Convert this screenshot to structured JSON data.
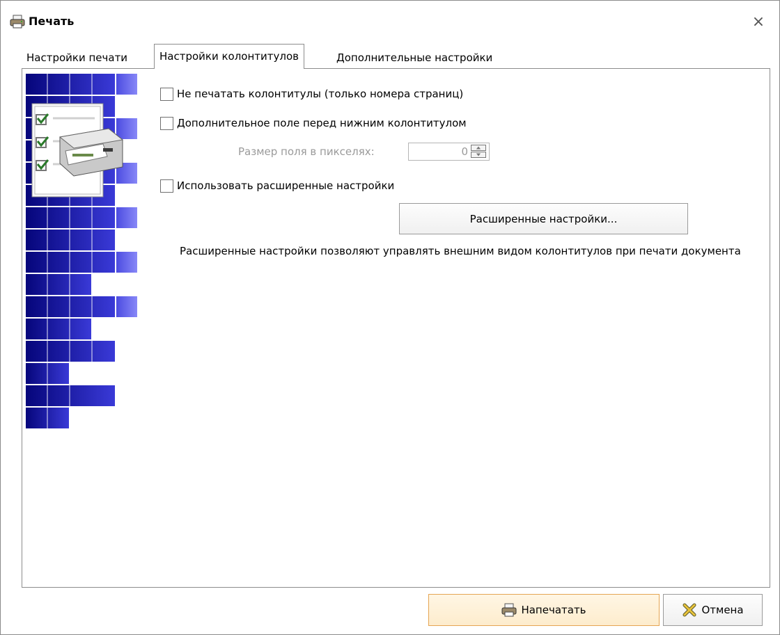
{
  "window": {
    "title": "Печать",
    "close_glyph": "×",
    "icon": "printer-icon"
  },
  "tabs": [
    {
      "label": "Настройки печати",
      "active": false
    },
    {
      "label": "Настройки колонтитулов",
      "active": true
    },
    {
      "label": "Дополнительные настройки",
      "active": false
    }
  ],
  "options": {
    "no_headers": {
      "label": "Не печатать колонтитулы (только номера страниц)",
      "checked": false
    },
    "extra_field": {
      "label": "Дополнительное поле перед нижним колонтитулом",
      "checked": false
    },
    "field_size": {
      "label": "Размер поля в пикселях:",
      "value": "0",
      "disabled": true
    },
    "use_advanced": {
      "label": "Использовать расширенные настройки",
      "checked": false
    }
  },
  "advanced_button": {
    "label": "Расширенные настройки..."
  },
  "description": "Расширенные настройки позволяют управлять внешним видом колонтитулов при печати документа",
  "footer": {
    "print_label": "Напечатать",
    "cancel_label": "Отмена",
    "print_icon": "printer-icon",
    "cancel_icon": "cancel-icon"
  },
  "colors": {
    "banner_dark": "#0a0a8a",
    "banner_light": "#6a6af0",
    "print_border": "#e5a552",
    "print_bg": "#fdeccd"
  }
}
